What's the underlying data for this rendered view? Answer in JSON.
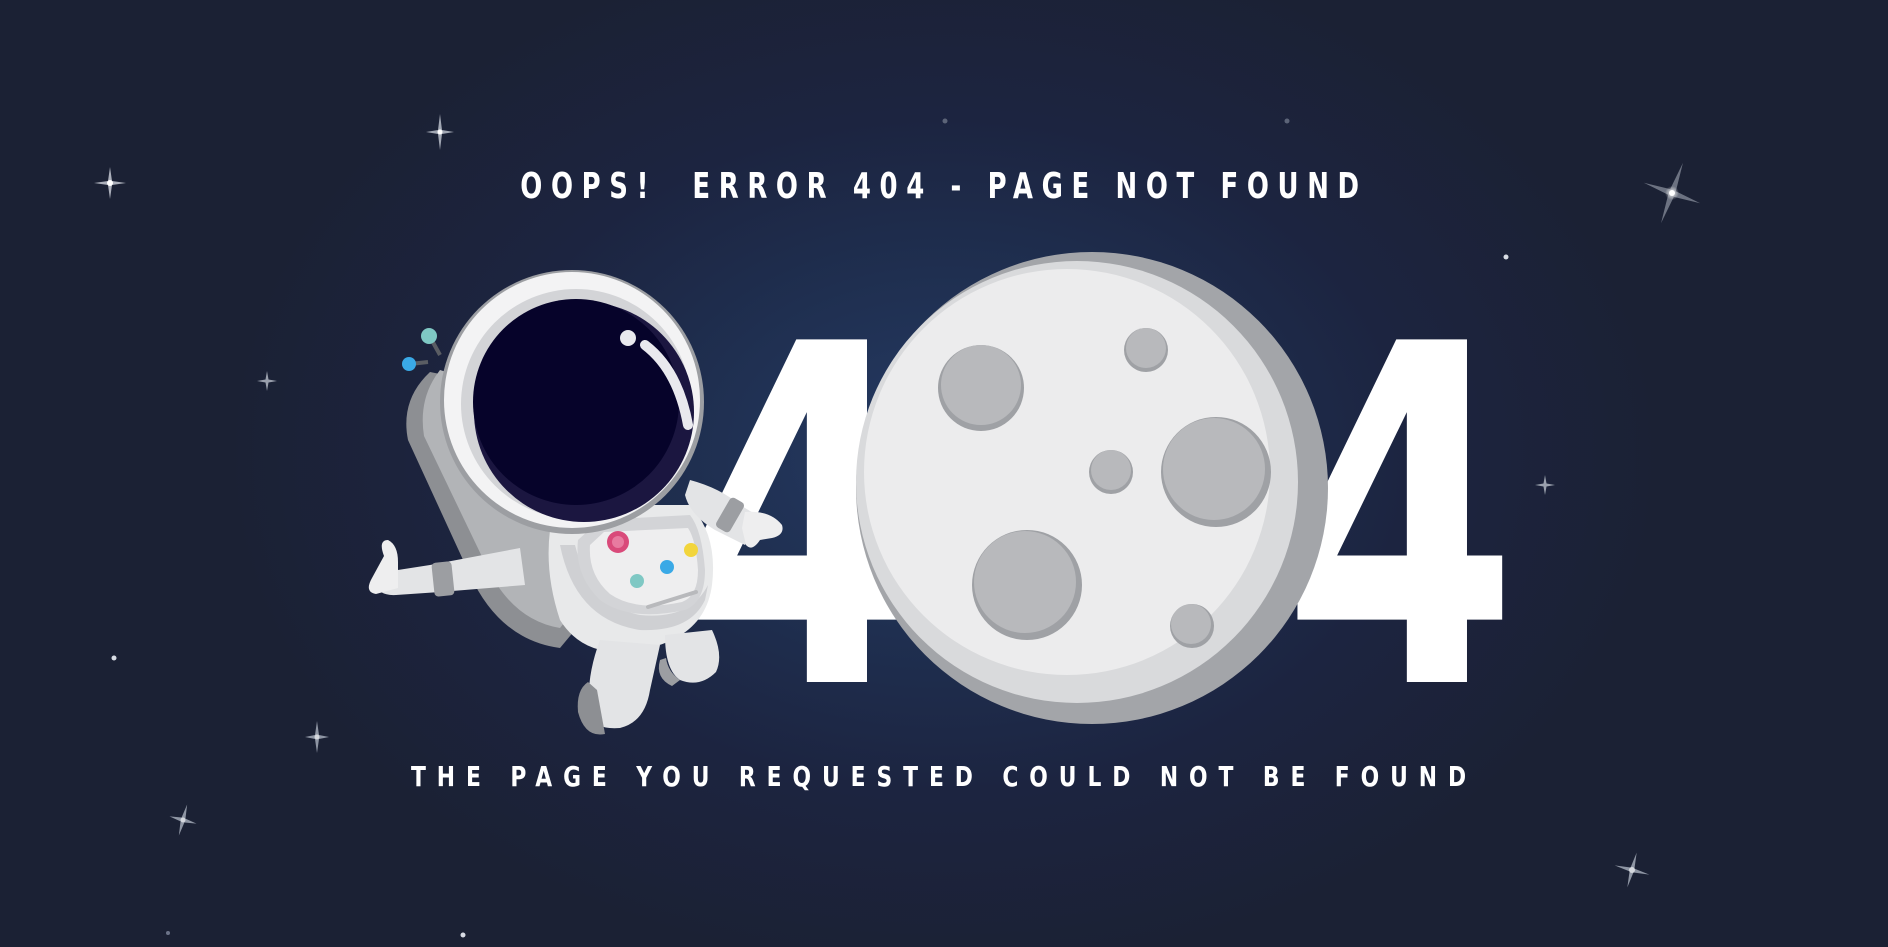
{
  "error": {
    "headline": "OOPS!  ERROR 404 - PAGE NOT FOUND",
    "code_left_digit": "4",
    "code_right_digit": "4",
    "message": "THE PAGE YOU REQUESTED COULD NOT BE FOUND"
  },
  "colors": {
    "background": "#1c2440",
    "text": "#ffffff",
    "moon": "#e9e9ea",
    "moon_shadow": "#a8aaad",
    "crater": "#b4b5b8",
    "visor": "#06032a",
    "button_pink": "#d94a7a",
    "button_teal": "#7fc8c4",
    "button_blue": "#3aa9e6",
    "button_yellow": "#f2d53c"
  },
  "icons": {
    "illustration": "astronaut-icon",
    "moon": "moon-icon",
    "decor": "star-icon"
  }
}
